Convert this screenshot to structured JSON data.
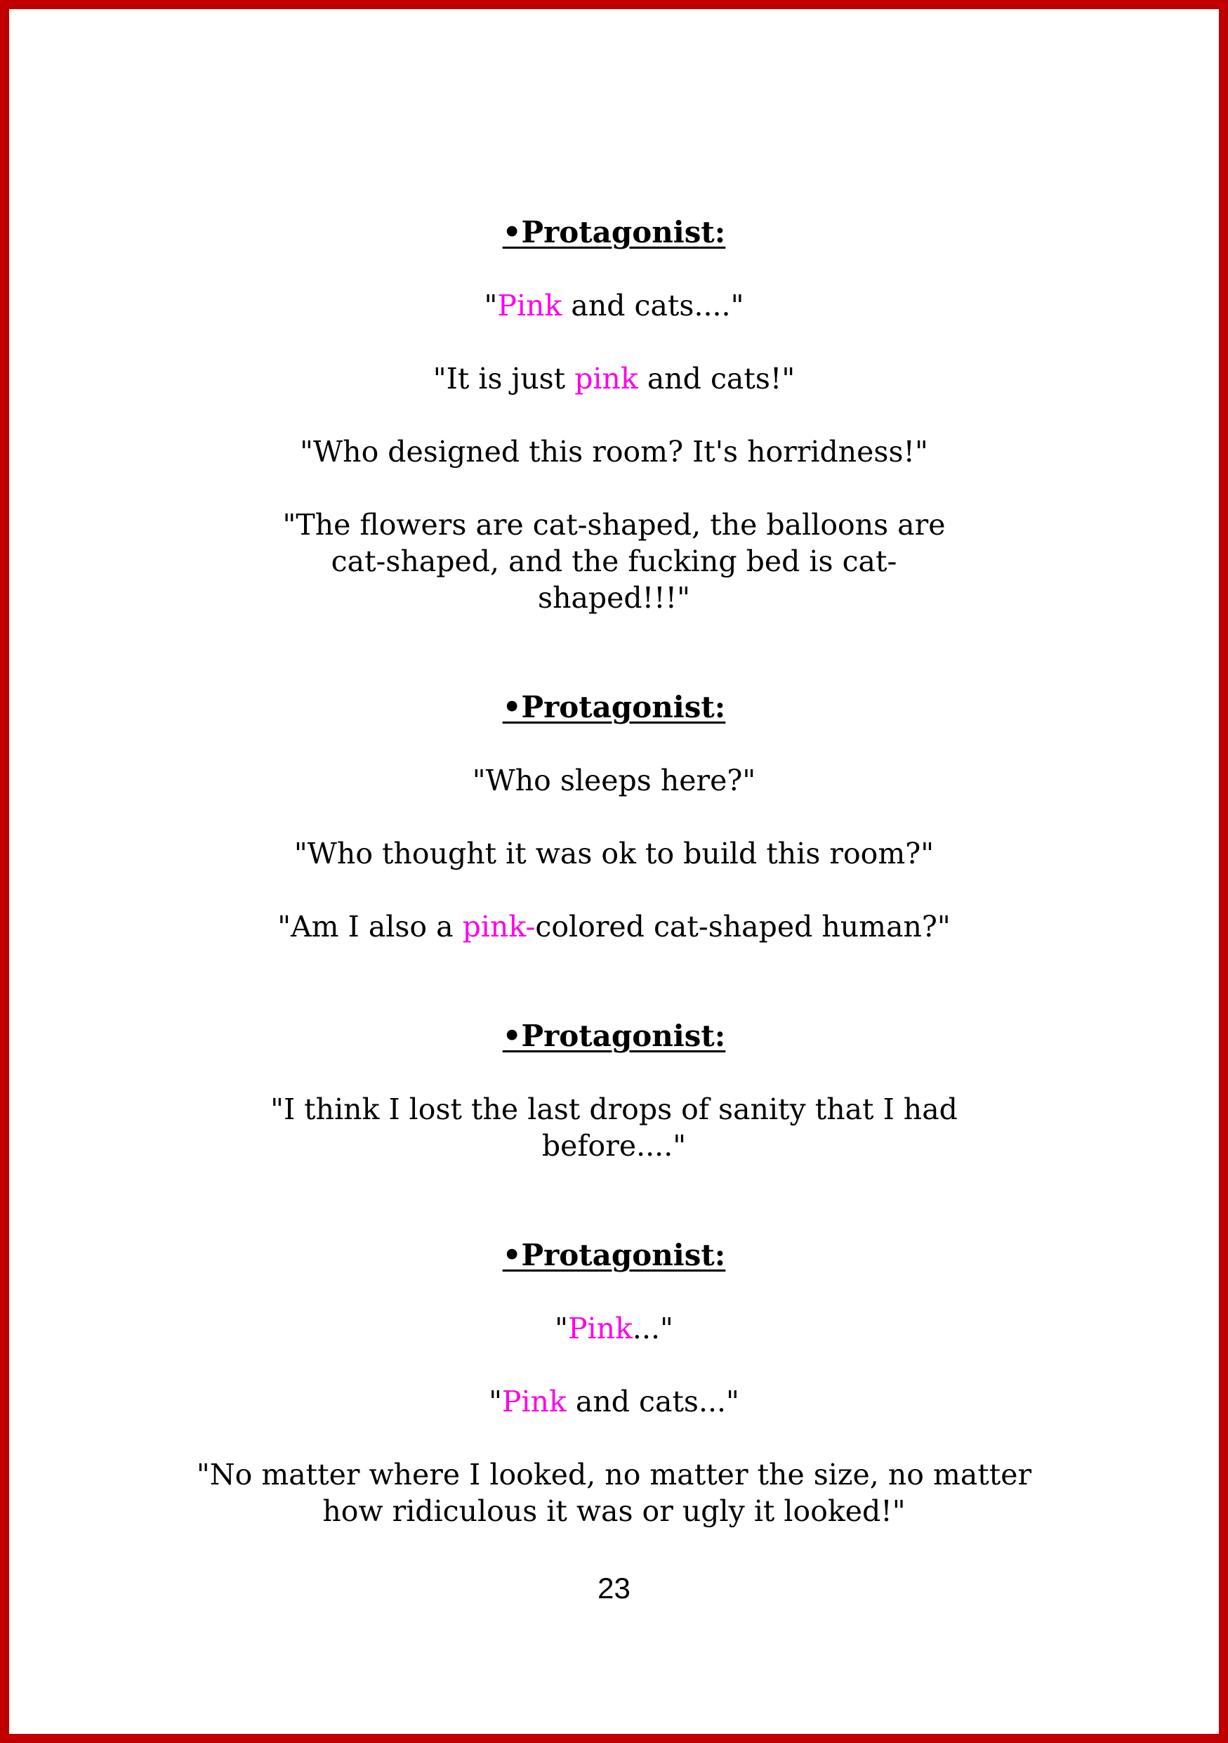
{
  "page": {
    "border_color": "#c00000",
    "accent_color": "#ff00e6",
    "page_number": "23"
  },
  "blocks": [
    {
      "speaker": "•Protagonist:",
      "lines": [
        {
          "pink": "Pink",
          "pre": "\"",
          "post": " and cats....\""
        },
        {
          "pre": "\"It is just ",
          "pink": "pink",
          "post": " and cats!\""
        },
        {
          "text": "\"Who designed this room? It's horridness!\""
        },
        {
          "text": "\"The flowers are cat-shaped, the balloons are cat-shaped, and the fucking bed is cat-shaped!!!\""
        }
      ]
    },
    {
      "speaker": "•Protagonist:",
      "lines": [
        {
          "text": "\"Who sleeps here?\""
        },
        {
          "text": "\"Who thought it was ok to build this room?\""
        },
        {
          "pre": "\"Am I also a ",
          "pink": "pink-",
          "post": "colored cat-shaped human?\""
        }
      ]
    },
    {
      "speaker": "•Protagonist:",
      "lines": [
        {
          "text": "\"I think I lost the last drops of sanity that I had before....\""
        }
      ]
    },
    {
      "speaker": "•Protagonist:",
      "lines": [
        {
          "pre": "\"",
          "pink": "Pink",
          "post": "...\""
        },
        {
          "pre": "\"",
          "pink": "Pink",
          "post": " and cats...\""
        },
        {
          "text": "\"No matter where I looked, no matter the size, no matter how ridiculous it was or ugly it looked!\""
        }
      ]
    }
  ]
}
